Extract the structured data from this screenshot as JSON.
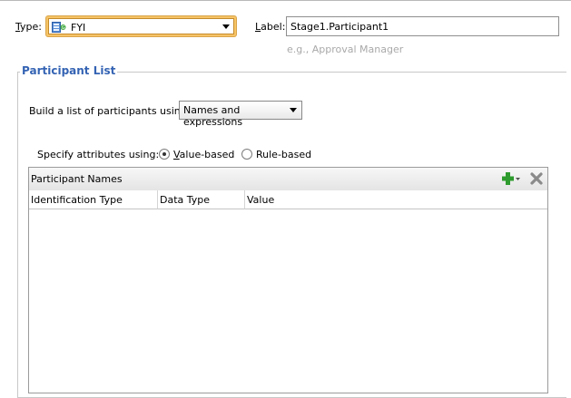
{
  "header": {
    "type_label": "Type:",
    "type_value": "FYI",
    "label_label": "Label:",
    "label_value": "Stage1.Participant1",
    "label_hint": "e.g., Approval Manager"
  },
  "participant_list": {
    "title": "Participant List",
    "build_label": "Build a list of participants using:",
    "build_value": "Names and expressions",
    "specify_label": "Specify attributes using:",
    "option_value_based": "Value-based",
    "option_rule_based": "Rule-based",
    "selected_option": "Value-based"
  },
  "table": {
    "title": "Participant Names",
    "columns": [
      "Identification Type",
      "Data Type",
      "Value"
    ],
    "rows": []
  },
  "icons": {
    "type": "fyi-task-icon",
    "add": "add-icon",
    "delete": "delete-icon"
  },
  "colors": {
    "group_title": "#3463b3",
    "combo_focus": "#f6c466",
    "add_icon": "#2e9b2e"
  }
}
